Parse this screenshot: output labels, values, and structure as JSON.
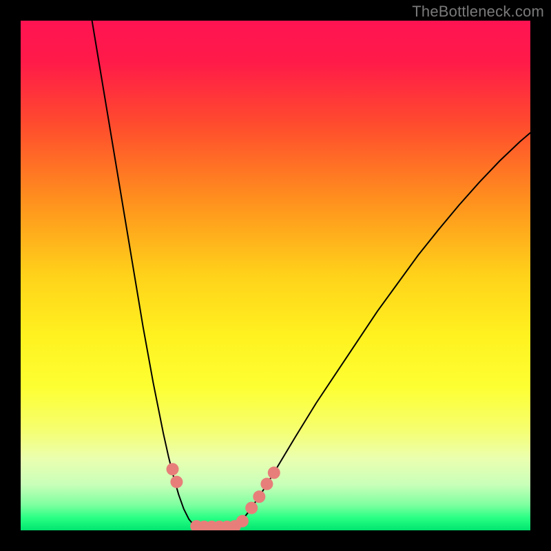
{
  "watermark": "TheBottleneck.com",
  "chart_data": {
    "type": "line",
    "title": "",
    "xlabel": "",
    "ylabel": "",
    "xlim": [
      0,
      100
    ],
    "ylim": [
      0,
      100
    ],
    "gradient_stops": [
      {
        "offset": 0.0,
        "color": "#ff1452"
      },
      {
        "offset": 0.08,
        "color": "#ff1a49"
      },
      {
        "offset": 0.2,
        "color": "#ff4a2e"
      },
      {
        "offset": 0.35,
        "color": "#ff8f1e"
      },
      {
        "offset": 0.5,
        "color": "#ffd21a"
      },
      {
        "offset": 0.62,
        "color": "#fff220"
      },
      {
        "offset": 0.72,
        "color": "#fdff33"
      },
      {
        "offset": 0.8,
        "color": "#f6ff6d"
      },
      {
        "offset": 0.86,
        "color": "#eaffb0"
      },
      {
        "offset": 0.91,
        "color": "#c9ffb9"
      },
      {
        "offset": 0.95,
        "color": "#7effa0"
      },
      {
        "offset": 0.975,
        "color": "#2aff84"
      },
      {
        "offset": 1.0,
        "color": "#00e56f"
      }
    ],
    "series": [
      {
        "name": "left-branch",
        "x": [
          14.0,
          15.0,
          16.0,
          17.0,
          18.0,
          19.0,
          20.0,
          21.0,
          22.0,
          23.0,
          24.0,
          25.0,
          26.0,
          27.0,
          28.0,
          29.0,
          30.0,
          31.0,
          32.0,
          33.0,
          34.0
        ],
        "y": [
          100.0,
          94.0,
          88.0,
          82.0,
          76.0,
          70.0,
          64.0,
          58.0,
          52.0,
          46.0,
          40.0,
          34.5,
          29.0,
          24.0,
          19.0,
          14.5,
          10.5,
          7.0,
          4.2,
          2.2,
          1.0
        ]
      },
      {
        "name": "flat-bottom",
        "x": [
          34.0,
          35.0,
          36.0,
          37.0,
          38.0,
          39.0,
          40.0,
          41.0,
          42.0,
          43.0
        ],
        "y": [
          1.0,
          0.8,
          0.7,
          0.7,
          0.7,
          0.7,
          0.7,
          0.8,
          1.0,
          1.4
        ]
      },
      {
        "name": "right-branch",
        "x": [
          43.0,
          45.0,
          48.0,
          51.0,
          54.0,
          58.0,
          62.0,
          66.0,
          70.0,
          74.0,
          78.0,
          82.0,
          86.0,
          90.0,
          94.0,
          98.0,
          100.0
        ],
        "y": [
          1.4,
          4.0,
          8.5,
          13.5,
          18.5,
          25.0,
          31.0,
          37.0,
          43.0,
          48.5,
          54.0,
          59.0,
          63.8,
          68.3,
          72.5,
          76.3,
          78.0
        ]
      }
    ],
    "markers": {
      "name": "highlight-dots",
      "color": "#e77e7a",
      "radius_px": 9,
      "points": [
        {
          "x": 29.8,
          "y": 12.0
        },
        {
          "x": 30.6,
          "y": 9.5
        },
        {
          "x": 34.5,
          "y": 0.8
        },
        {
          "x": 36.0,
          "y": 0.7
        },
        {
          "x": 37.5,
          "y": 0.7
        },
        {
          "x": 39.0,
          "y": 0.7
        },
        {
          "x": 40.5,
          "y": 0.7
        },
        {
          "x": 42.0,
          "y": 0.8
        },
        {
          "x": 43.5,
          "y": 1.8
        },
        {
          "x": 45.3,
          "y": 4.4
        },
        {
          "x": 46.8,
          "y": 6.6
        },
        {
          "x": 48.3,
          "y": 9.1
        },
        {
          "x": 49.7,
          "y": 11.3
        }
      ]
    }
  }
}
